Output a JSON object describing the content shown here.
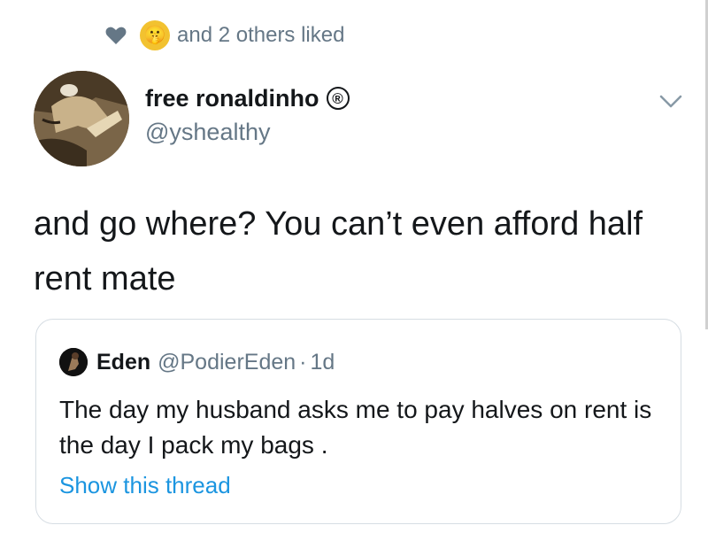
{
  "liked_by": {
    "text": "and 2 others liked",
    "heart_icon": "heart-icon",
    "liker_avatar_emoji": "🤫"
  },
  "tweet": {
    "author_name": "free ronaldinho",
    "author_badge": "®",
    "author_handle": "@yshealthy",
    "text": "and go where? You can’t even afford half rent mate"
  },
  "quoted": {
    "author_name": "Eden",
    "author_handle": "@PodierEden",
    "separator": "·",
    "time": "1d",
    "text": "The day my husband asks me to pay halves on rent is the day I pack my bags .",
    "show_thread_label": "Show this thread"
  },
  "colors": {
    "text_primary": "#14171a",
    "text_secondary": "#657786",
    "link": "#1b95e0",
    "border": "#d6dde3"
  }
}
